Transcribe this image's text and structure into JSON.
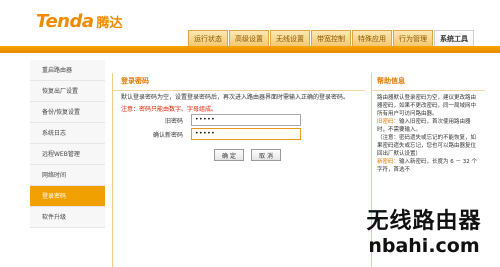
{
  "brand": {
    "name": "Tenda",
    "name_cn": "腾达",
    "color": "#f08a00"
  },
  "tabs": [
    {
      "label": "运行状态"
    },
    {
      "label": "高级设置"
    },
    {
      "label": "无线设置"
    },
    {
      "label": "带宽控制"
    },
    {
      "label": "特殊应用"
    },
    {
      "label": "行为管理"
    },
    {
      "label": "系统工具",
      "active": true
    }
  ],
  "sidebar": {
    "items": [
      {
        "label": "重启路由器"
      },
      {
        "label": "恢复出厂设置"
      },
      {
        "label": "备份/恢复设置"
      },
      {
        "label": "系统日志"
      },
      {
        "label": "远程WEB管理"
      },
      {
        "label": "网络时间"
      },
      {
        "label": "登录密码",
        "active": true
      },
      {
        "label": "软件升级"
      }
    ]
  },
  "main": {
    "title": "登录密码",
    "desc": "默认登录密码为空，设置登录密码后，再次进入路由器界面时需输入正确的登录密码。",
    "note": "注意：密码只能由数字、字母组成。",
    "old_password_label": "旧密码",
    "old_password_value": "•••••",
    "new_password_label": "确认新密码",
    "new_password_value": "•••••",
    "ok_button": "确 定",
    "cancel_button": "取 消"
  },
  "help": {
    "title": "帮助信息",
    "intro": "路由器默认登录密码为空，建议更改路由器密码，如果不更改密码，同一局域网中所有用户可访问路由器。",
    "item1_label": "旧密码：",
    "item1_text": "输入旧密码，首次使用路由器时，不需要输入。",
    "item1_note": "（注意：密码遗失或忘记的不能恢复，如果密码遗失或忘记，您也可以路由器复位回出厂默认设置）",
    "item2_label": "新密码：",
    "item2_text": "输入新密码，长度为 6 － 32 个字符，首选不"
  },
  "watermark": {
    "cn": "无线路由器",
    "en": "nbahi.com"
  }
}
